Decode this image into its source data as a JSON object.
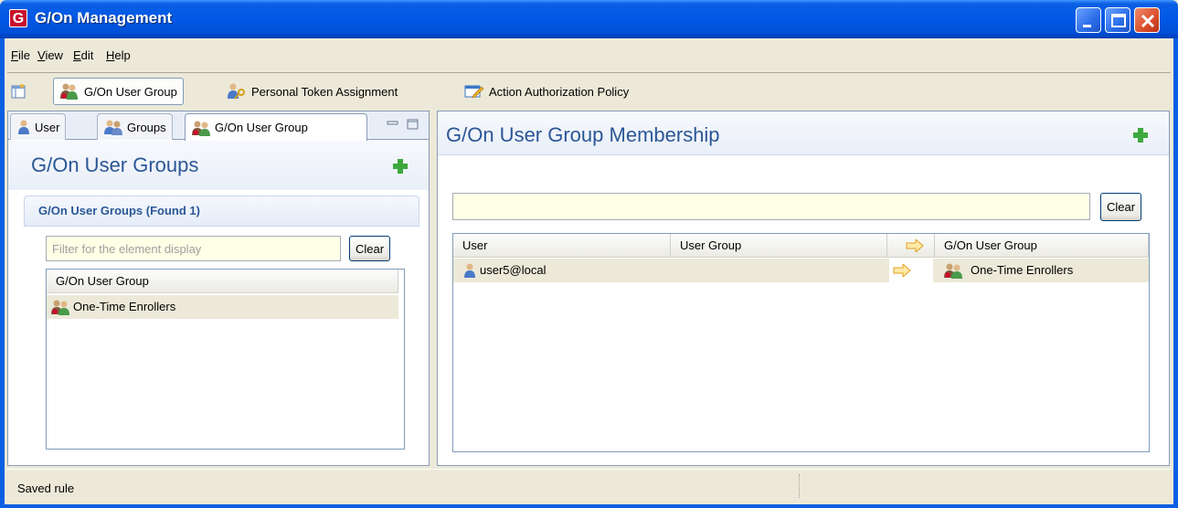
{
  "window": {
    "logo_letter": "G",
    "title": "G/On Management",
    "controls": [
      "minimize",
      "maximize",
      "close"
    ]
  },
  "menu": {
    "items": [
      {
        "label": "File"
      },
      {
        "label": "View"
      },
      {
        "label": "Edit"
      },
      {
        "label": "Help"
      }
    ]
  },
  "toolbar": {
    "items": [
      {
        "label": "G/On User Group",
        "icon": "user-group-icon",
        "active": true
      },
      {
        "label": "Personal Token Assignment",
        "icon": "token-assignment-icon"
      },
      {
        "label": "Action Authorization Policy",
        "icon": "policy-icon"
      }
    ]
  },
  "left_panel": {
    "tabs": [
      {
        "label": "User",
        "icon": "user-icon"
      },
      {
        "label": "Groups",
        "icon": "groups-icon"
      },
      {
        "label": "G/On User Group",
        "icon": "user-group-icon",
        "active": true
      }
    ],
    "title": "G/On User Groups",
    "section_title": "G/On User Groups (Found 1)",
    "filter": {
      "placeholder": "Filter for the element display",
      "value": ""
    },
    "clear_label": "Clear",
    "list": {
      "column": "G/On User Group",
      "rows": [
        {
          "label": "One-Time Enrollers"
        }
      ]
    }
  },
  "right_panel": {
    "title": "G/On User Group Membership",
    "search": {
      "value": ""
    },
    "clear_label": "Clear",
    "table": {
      "columns": [
        "User",
        "User Group",
        "G/On User Group"
      ],
      "rows": [
        {
          "user": "user5@local",
          "user_group": "",
          "gon_user_group": "One-Time Enrollers"
        }
      ]
    }
  },
  "status": {
    "text": "Saved rule"
  },
  "colors": {
    "titlebar": "#0058E6",
    "header_text": "#2B5796",
    "input_bg": "#FFFFE6",
    "add_green": "#3DA83D",
    "arrow_orange": "#F0B030"
  }
}
